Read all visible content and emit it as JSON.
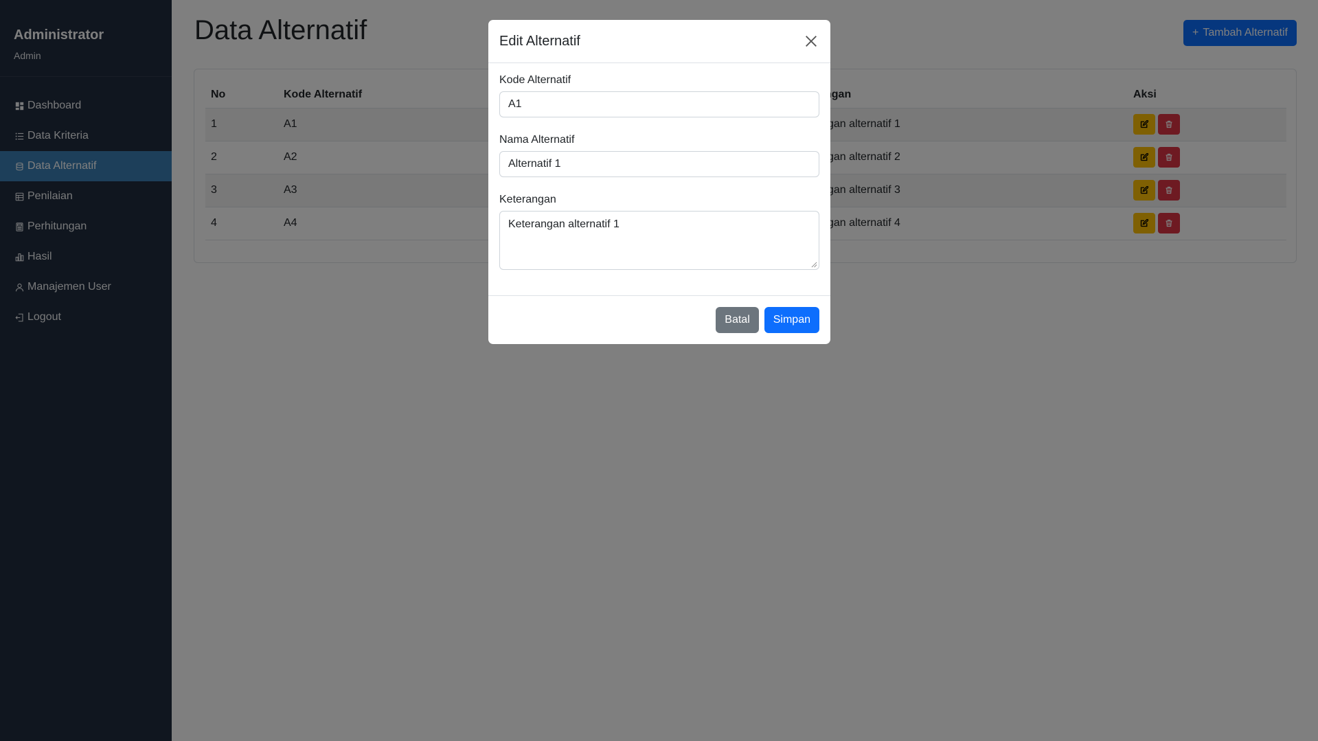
{
  "sidebar": {
    "title": "Administrator",
    "role": "Admin",
    "items": [
      {
        "label": "Dashboard",
        "icon": "dashboard-icon"
      },
      {
        "label": "Data Kriteria",
        "icon": "list-icon"
      },
      {
        "label": "Data Alternatif",
        "icon": "database-icon",
        "active": true
      },
      {
        "label": "Penilaian",
        "icon": "table-icon"
      },
      {
        "label": "Perhitungan",
        "icon": "calculator-icon"
      },
      {
        "label": "Hasil",
        "icon": "bar-chart-icon"
      },
      {
        "label": "Manajemen User",
        "icon": "user-icon"
      },
      {
        "label": "Logout",
        "icon": "logout-icon"
      }
    ]
  },
  "main": {
    "title": "Data Alternatif",
    "add_button": "Tambah Alternatif",
    "table": {
      "headers": [
        "No",
        "Kode Alternatif",
        "ngan",
        "Aksi"
      ],
      "rows": [
        {
          "no": "1",
          "kode": "A1",
          "ket": "gan alternatif 1"
        },
        {
          "no": "2",
          "kode": "A2",
          "ket": "gan alternatif 2"
        },
        {
          "no": "3",
          "kode": "A3",
          "ket": "gan alternatif 3"
        },
        {
          "no": "4",
          "kode": "A4",
          "ket": "gan alternatif 4"
        }
      ]
    }
  },
  "modal": {
    "title": "Edit Alternatif",
    "fields": {
      "kode_label": "Kode Alternatif",
      "kode_value": "A1",
      "nama_label": "Nama Alternatif",
      "nama_value": "Alternatif 1",
      "ket_label": "Keterangan",
      "ket_value": "Keterangan alternatif 1"
    },
    "cancel_label": "Batal",
    "save_label": "Simpan"
  },
  "colors": {
    "sidebar_bg": "#212c3f",
    "active_item": "#3b7fb4",
    "primary": "#0d6efd",
    "secondary": "#6c757d",
    "warning": "#ffc107",
    "danger": "#dc3545"
  }
}
